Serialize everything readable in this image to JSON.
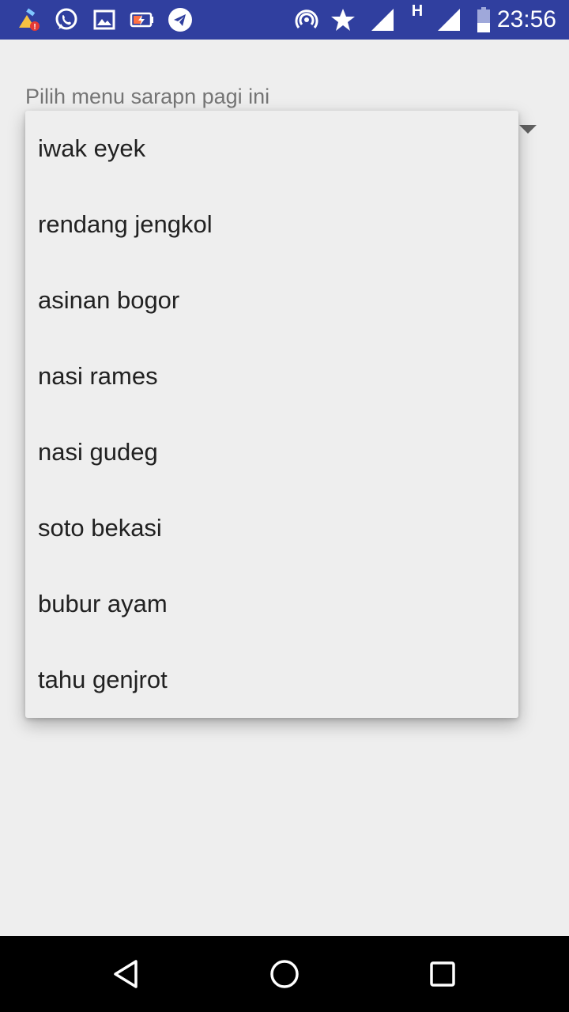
{
  "status_bar": {
    "time": "23:56",
    "network_type": "H",
    "background_color": "#303f9f",
    "icons": [
      "cleaner-icon",
      "whatsapp-icon",
      "gallery-icon",
      "battery-saver-icon",
      "telegram-icon",
      "hotspot-icon",
      "star-icon",
      "signal-icon",
      "signal-icon",
      "battery-icon"
    ]
  },
  "spinner": {
    "label": "Pilih menu sarapn pagi ini"
  },
  "dropdown": {
    "items": [
      "iwak eyek",
      "rendang jengkol",
      "asinan bogor",
      "nasi rames",
      "nasi gudeg",
      "soto bekasi",
      "bubur ayam",
      "tahu genjrot"
    ]
  },
  "nav_bar": {
    "buttons": [
      "back-icon",
      "home-icon",
      "recents-icon"
    ]
  }
}
